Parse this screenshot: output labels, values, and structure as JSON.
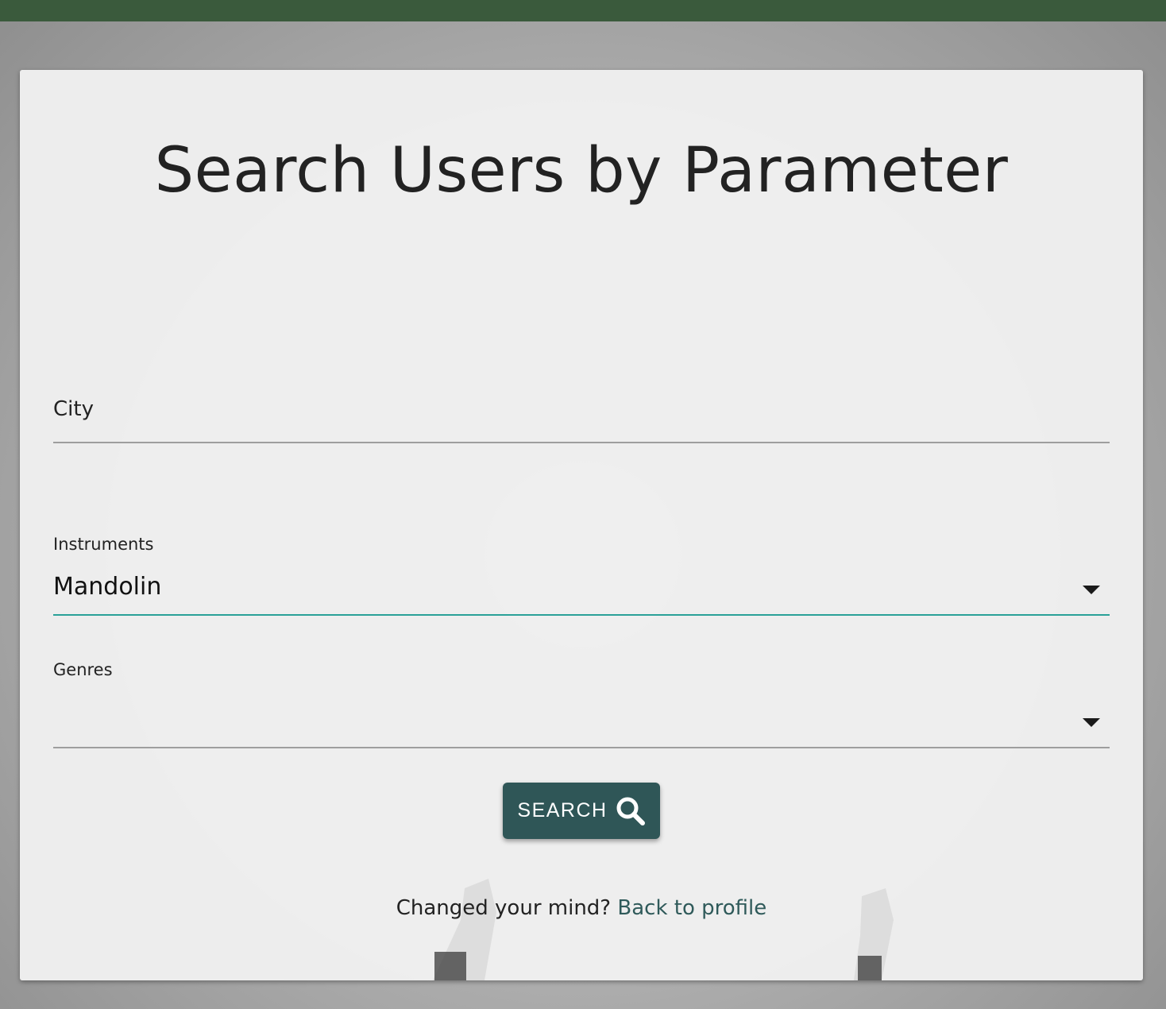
{
  "page": {
    "title": "Search Users by Parameter"
  },
  "form": {
    "city": {
      "placeholder": "City",
      "value": ""
    },
    "instruments": {
      "label": "Instruments",
      "selected": "Mandolin"
    },
    "genres": {
      "label": "Genres",
      "selected": ""
    },
    "search_button": {
      "label": "SEARCH",
      "icon": "search-icon"
    }
  },
  "footer": {
    "prompt": "Changed your mind?",
    "link_label": "Back to profile"
  },
  "colors": {
    "topbar": "#3a5a3c",
    "button": "#2f5657",
    "focus_underline": "#2aa198",
    "link": "#2f5a5a"
  }
}
